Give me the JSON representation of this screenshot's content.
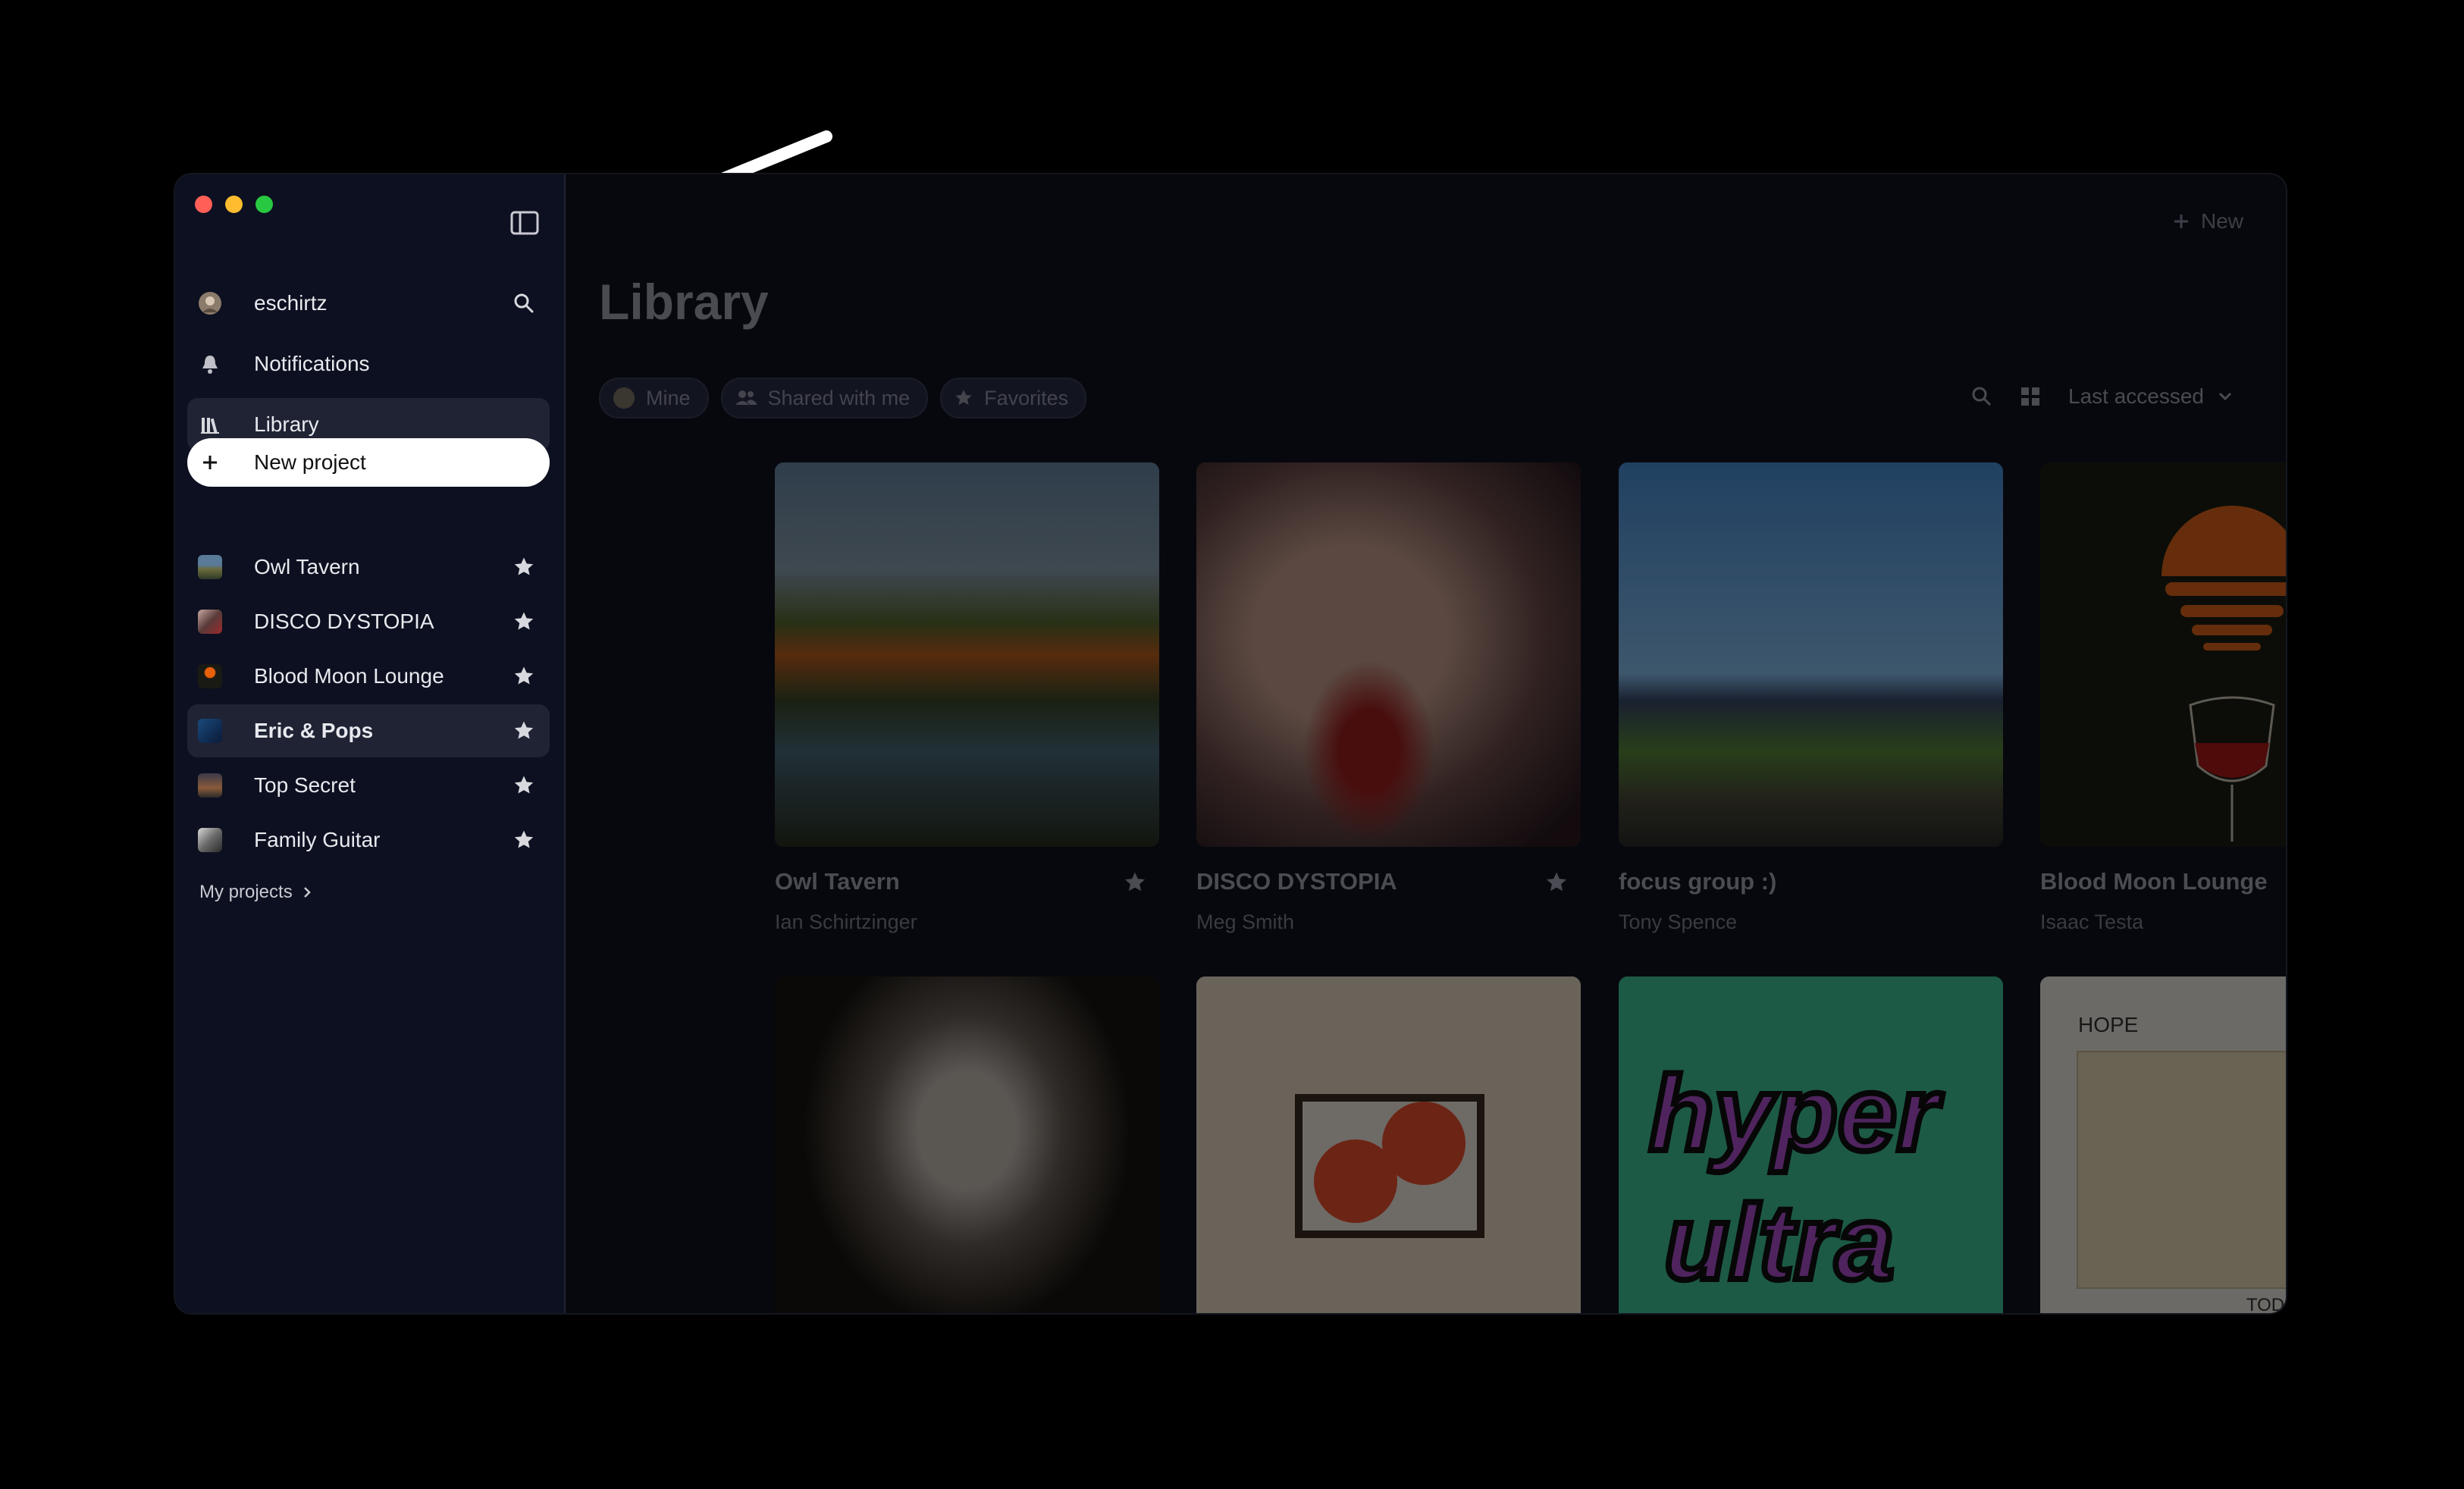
{
  "sidebar": {
    "user": "eschirtz",
    "notifications": "Notifications",
    "library": "Library",
    "new_project": "New project",
    "projects": [
      {
        "name": "Owl Tavern"
      },
      {
        "name": "DISCO DYSTOPIA"
      },
      {
        "name": "Blood Moon Lounge"
      },
      {
        "name": "Eric & Pops"
      },
      {
        "name": "Top Secret"
      },
      {
        "name": "Family Guitar"
      }
    ],
    "my_projects": "My projects"
  },
  "main": {
    "new_label": "New",
    "title": "Library",
    "filters": [
      "Mine",
      "Shared with me",
      "Favorites"
    ],
    "sort_label": "Last accessed",
    "cards": [
      {
        "title": "Owl Tavern",
        "author": "Ian Schirtzinger",
        "favorited": true
      },
      {
        "title": "DISCO DYSTOPIA",
        "author": "Meg Smith",
        "favorited": true
      },
      {
        "title": "focus group :)",
        "author": "Tony Spence",
        "favorited": false
      },
      {
        "title": "Blood Moon Lounge",
        "author": "Isaac Testa",
        "favorited": true
      },
      {
        "title": "",
        "author": "",
        "favorited": false
      },
      {
        "title": "",
        "author": "",
        "favorited": false
      },
      {
        "title": "",
        "author": "",
        "favorited": false,
        "art_text_1": "hyper",
        "art_text_2": "ultra"
      },
      {
        "title": "",
        "author": "",
        "favorited": false,
        "art_text_1": "HOPE",
        "art_text_2": "TODD BOSTON"
      }
    ]
  },
  "colors": {
    "sidebar_bg": "#0c1020",
    "active_row": "#1f2334",
    "traffic_red": "#ff5f57",
    "traffic_yellow": "#febc2e",
    "traffic_green": "#28c840"
  }
}
